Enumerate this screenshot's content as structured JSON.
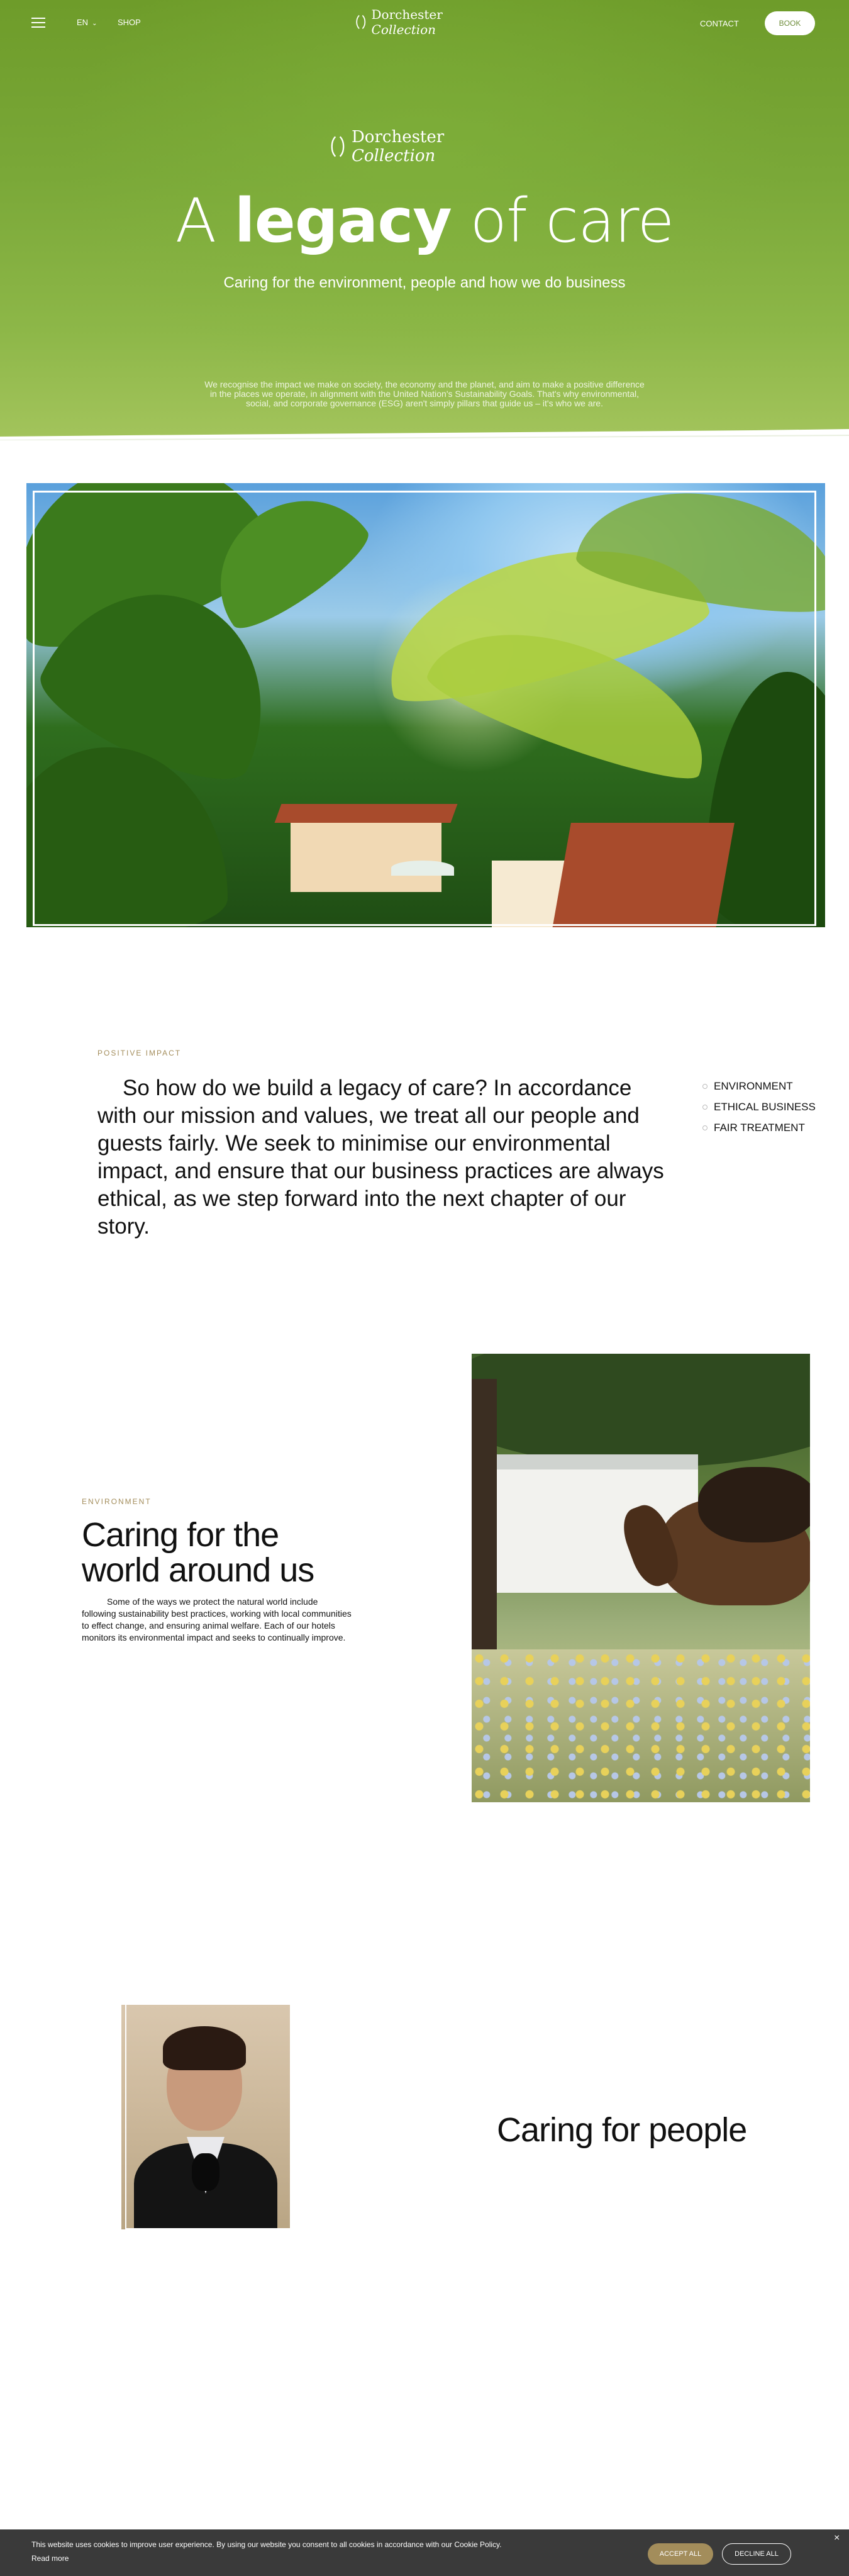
{
  "nav": {
    "language": "EN",
    "shop": "SHOP",
    "brand_main": "Dorchester",
    "brand_italic": "Collection",
    "contact": "CONTACT",
    "book": "BOOK"
  },
  "hero": {
    "brand_main": "Dorchester",
    "brand_italic": "Collection",
    "title_pre": "A",
    "title_bold": "legacy",
    "title_post": "of care",
    "subtitle": "Caring for the environment, people and how we do business",
    "paragraph": "We recognise the impact we make on society, the economy and the planet, and aim to make a positive difference in the places we operate, in alignment with the United Nation's Sustainability Goals. That's why environmental, social, and corporate governance (ESG) aren't simply pillars that guide us – it's who we are."
  },
  "impact": {
    "eyebrow": "POSITIVE IMPACT",
    "text": "So how do we build a legacy of care? In accordance with our mission and values, we treat all our people and guests fairly. We seek to minimise our environmental impact, and ensure that our business practices are always ethical, as we step forward into the next chapter of our story.",
    "links": [
      "ENVIRONMENT",
      "ETHICAL BUSINESS",
      "FAIR TREATMENT"
    ]
  },
  "environment": {
    "eyebrow": "ENVIRONMENT",
    "title": "Caring for the world around us",
    "paragraph": "Some of the ways we protect the natural world include following sustainability best practices, working with local communities to effect change, and ensuring animal welfare. Each of our hotels monitors its environmental impact and seeks to continually improve."
  },
  "people": {
    "title": "Caring for people"
  },
  "cookie": {
    "text": "This website uses cookies to improve user experience. By using our website you consent to all cookies in accordance with our Cookie Policy.",
    "read_more": "Read more",
    "accept": "ACCEPT ALL",
    "decline": "DECLINE ALL",
    "close": "×"
  },
  "colors": {
    "hero_green": "#7aa838",
    "accent_gold": "#a38d5b",
    "cookie_bg": "#3a3a3a"
  }
}
